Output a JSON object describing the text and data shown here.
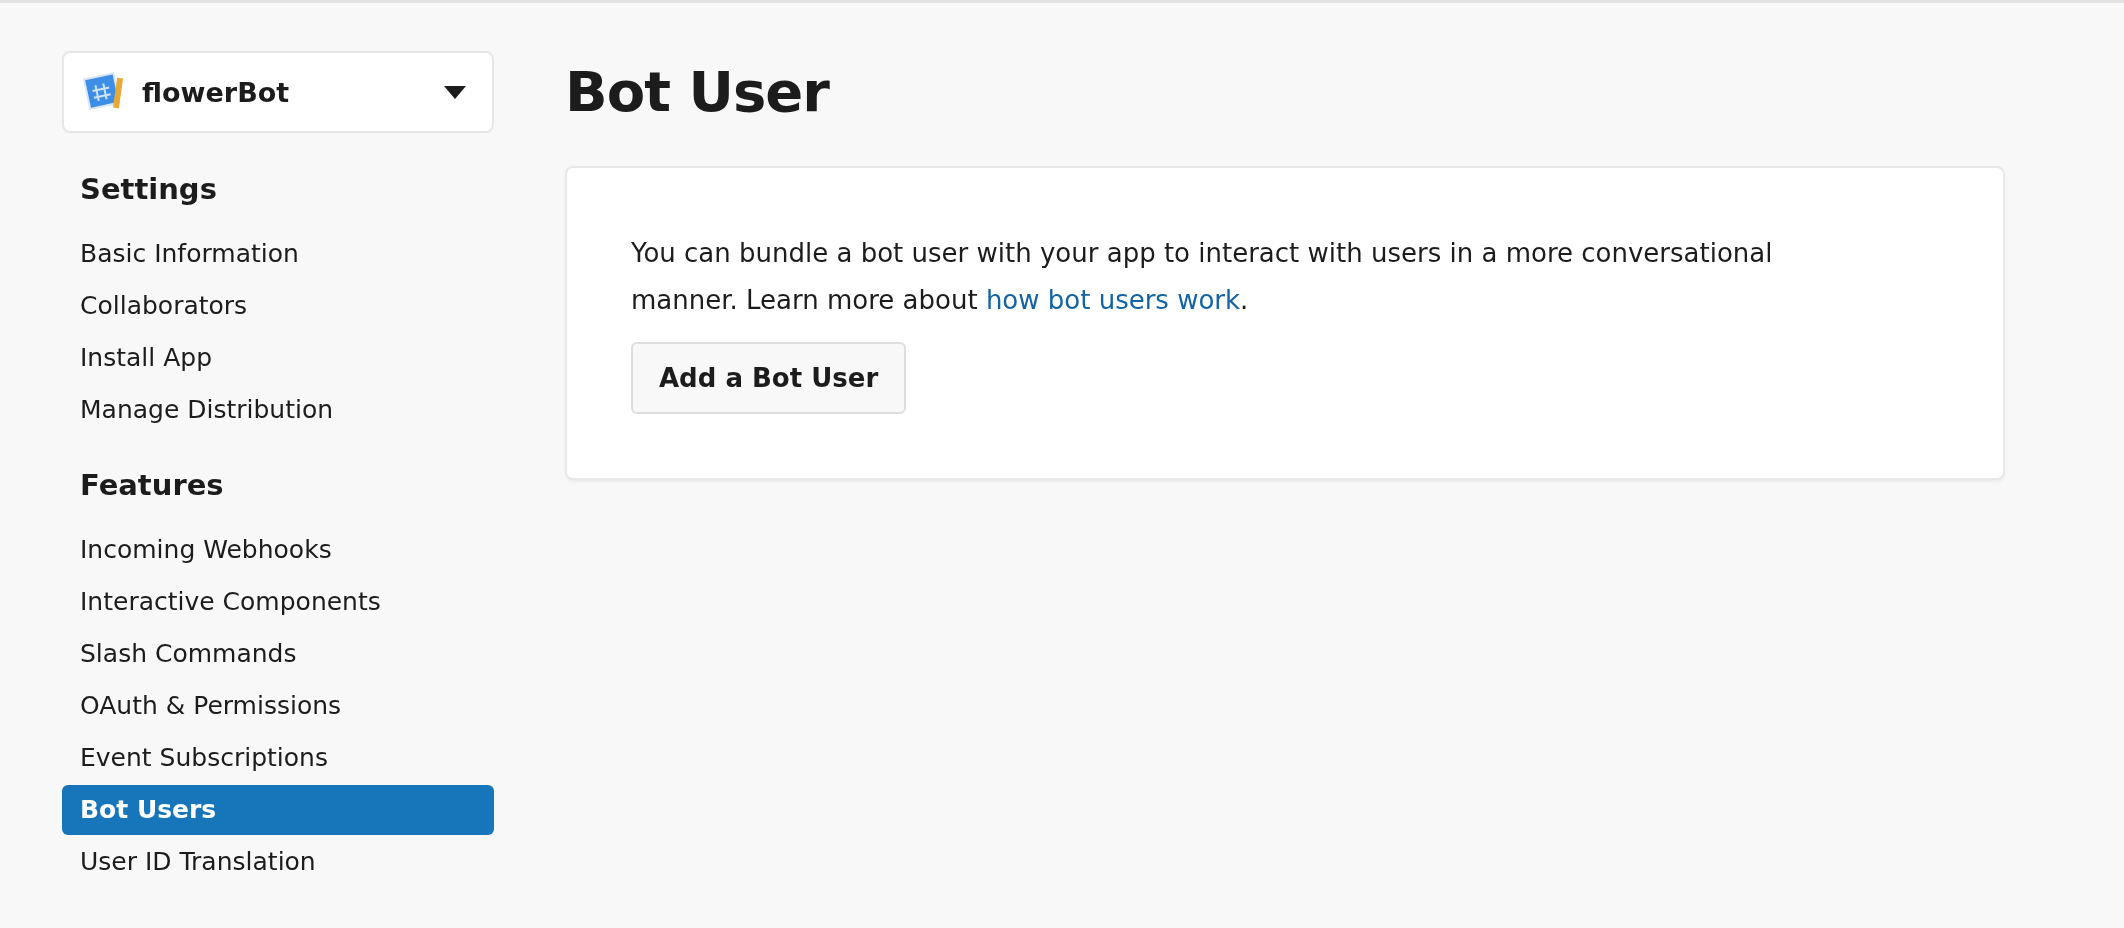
{
  "app_selector": {
    "name": "flowerBot",
    "expanded": false
  },
  "sidebar": {
    "sections": [
      {
        "heading": "Settings",
        "items": [
          {
            "label": "Basic Information",
            "selected": false
          },
          {
            "label": "Collaborators",
            "selected": false
          },
          {
            "label": "Install App",
            "selected": false
          },
          {
            "label": "Manage Distribution",
            "selected": false
          }
        ]
      },
      {
        "heading": "Features",
        "items": [
          {
            "label": "Incoming Webhooks",
            "selected": false
          },
          {
            "label": "Interactive Components",
            "selected": false
          },
          {
            "label": "Slash Commands",
            "selected": false
          },
          {
            "label": "OAuth & Permissions",
            "selected": false
          },
          {
            "label": "Event Subscriptions",
            "selected": false
          },
          {
            "label": "Bot Users",
            "selected": true
          },
          {
            "label": "User ID Translation",
            "selected": false
          }
        ]
      }
    ]
  },
  "page": {
    "title": "Bot User",
    "description": {
      "before": "You can bundle a bot user with your app to interact with users in a more conversational manner. Learn more about ",
      "link": "how bot users work",
      "after": "."
    },
    "button": "Add a Bot User"
  }
}
